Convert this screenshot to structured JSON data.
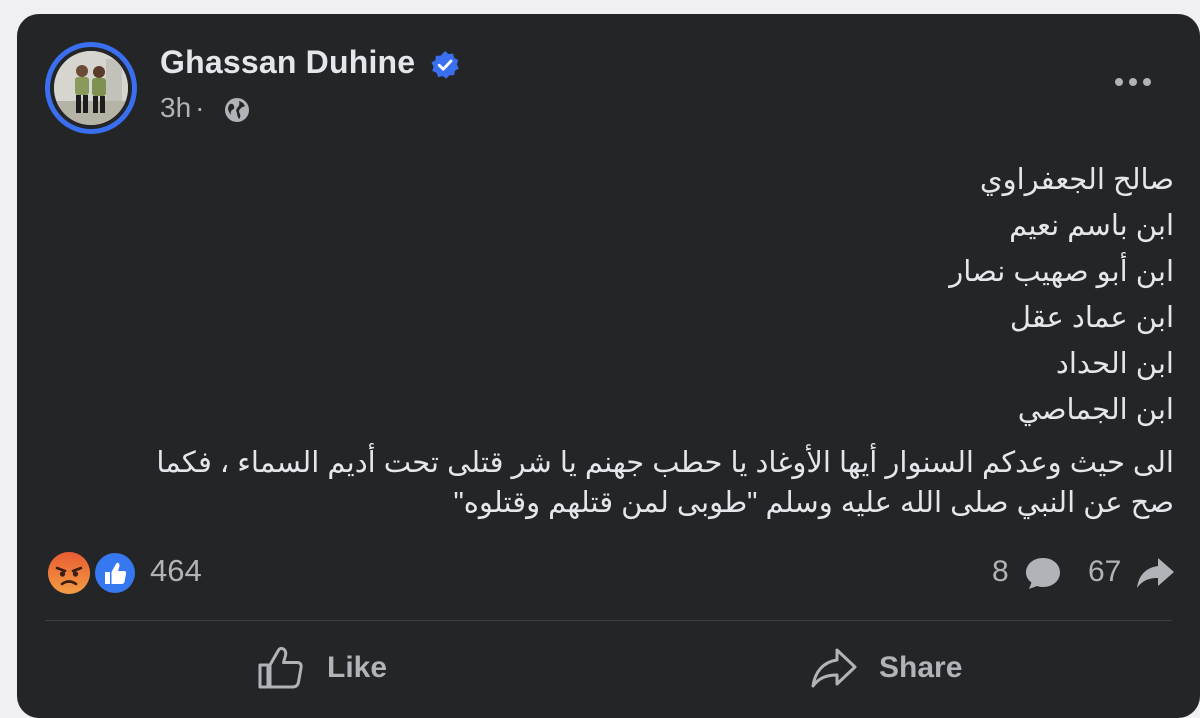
{
  "post": {
    "author": {
      "name": "Ghassan Duhine",
      "verified": true
    },
    "time": "3h",
    "separator": "·",
    "audience_icon": "globe-icon",
    "lines": [
      "صالح الجعفراوي",
      "ابن باسم نعيم",
      "ابن أبو صهيب نصار",
      "ابن عماد عقل",
      "ابن الحداد",
      "ابن الجماصي"
    ],
    "paragraph": [
      "الى حيث وعدكم السنوار أيها الأوغاد يا حطب جهنم يا شر قتلى تحت أديم السماء ، فكما",
      "صح عن النبي صلى الله عليه وسلم \"طوبى لمن قتلهم وقتلوه\""
    ]
  },
  "stats": {
    "reactions": [
      "angry-reaction-icon",
      "like-reaction-icon"
    ],
    "reaction_count": "464",
    "comment_count": "8",
    "share_count": "67"
  },
  "actions": {
    "like_label": "Like",
    "share_label": "Share"
  },
  "colors": {
    "card_background": "#242526",
    "text_primary": "#e4e6eb",
    "text_secondary": "#b0b3b8",
    "accent_blue": "#3a6ff0",
    "angry_orange": "#f0803c"
  }
}
